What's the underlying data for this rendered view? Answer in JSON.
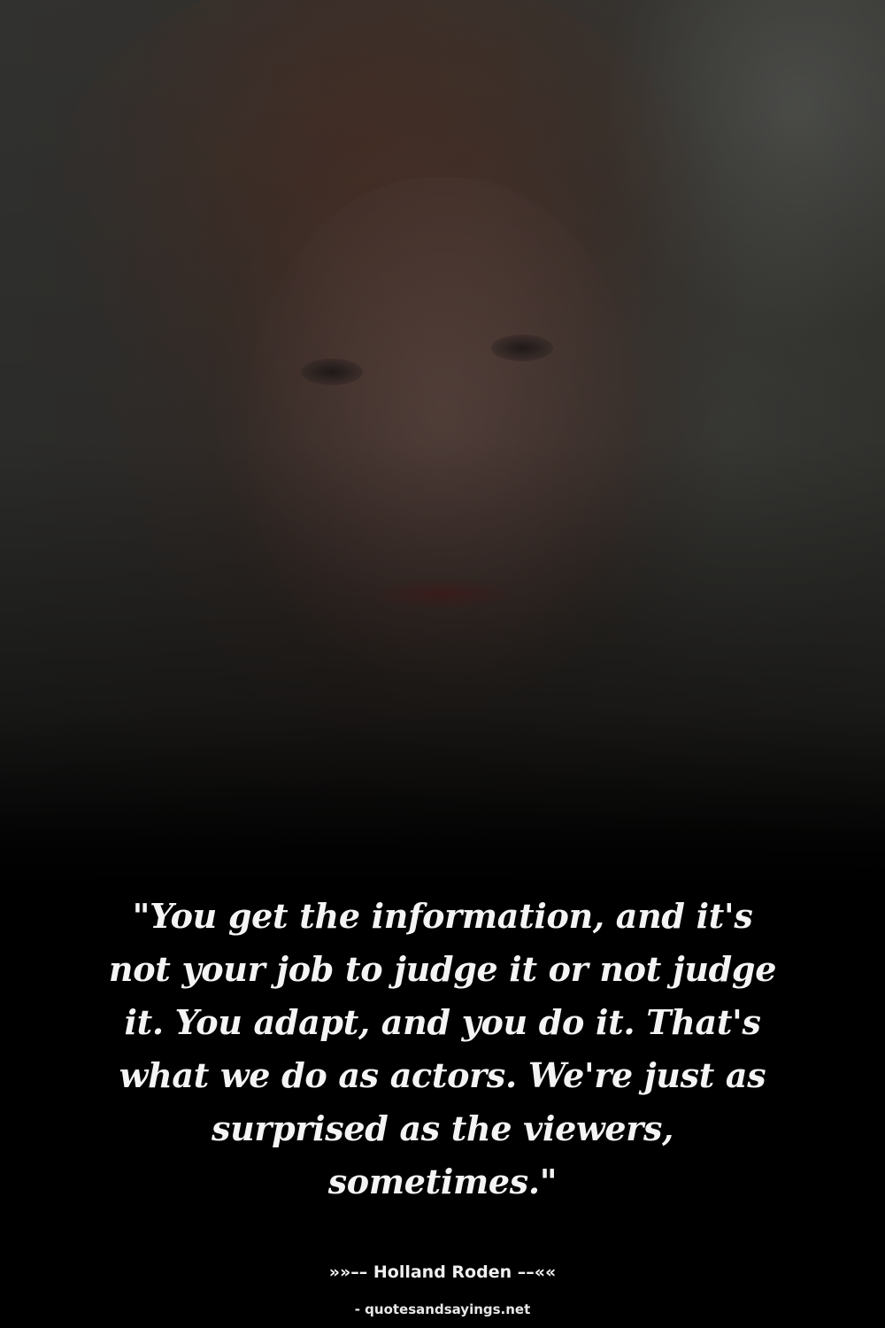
{
  "quote": {
    "text": "\"You get the information, and it's not your job to judge it or not judge it. You adapt, and you do it. That's what we do as actors. We're just as surprised as the viewers, sometimes.\""
  },
  "attribution": {
    "author_line": "»»–– Holland Roden ––««"
  },
  "source": {
    "label": "- quotesandsayings.net"
  },
  "colors": {
    "background": "#000000",
    "text": "#f4f4f4"
  }
}
